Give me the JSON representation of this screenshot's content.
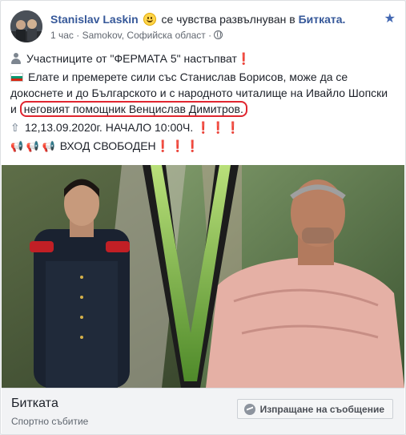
{
  "post": {
    "author": "Stanislav Laskin",
    "feeling_text": "се чувства развълнуван",
    "in_word": "в",
    "place": "Биткатa.",
    "time": "1 час",
    "location": "Samokov, Софийска област",
    "separator": "·"
  },
  "body": {
    "line1_text": "Участниците от \"ФЕРМАТА 5\" настъпват",
    "line1_excl": "❗",
    "line2_text": "Елате и премерете сили със Станислав Борисов, може да се докоснете и до Българското и с народното читалище на Ивайло Шопски и",
    "line2_circled": "неговият помощник Венцислав Димитров.",
    "line3_text": "12,13.09.2020г. НАЧАЛО 10:00Ч.",
    "line3_excl": "❗❗❗",
    "line4_text": "ВХОД СВОБОДЕН",
    "line4_excl": "❗❗❗",
    "mega_icons": "📢 📢 📢"
  },
  "event": {
    "title": "Биткатa",
    "subtitle": "Спортно събитие",
    "message_button": "Изпращане на съобщение"
  },
  "icons": {
    "star": "star-icon",
    "globe": "globe-icon",
    "messenger": "messenger-icon"
  },
  "colors": {
    "link": "#365899",
    "accent": "#4267b2",
    "circle": "#e0252f"
  }
}
